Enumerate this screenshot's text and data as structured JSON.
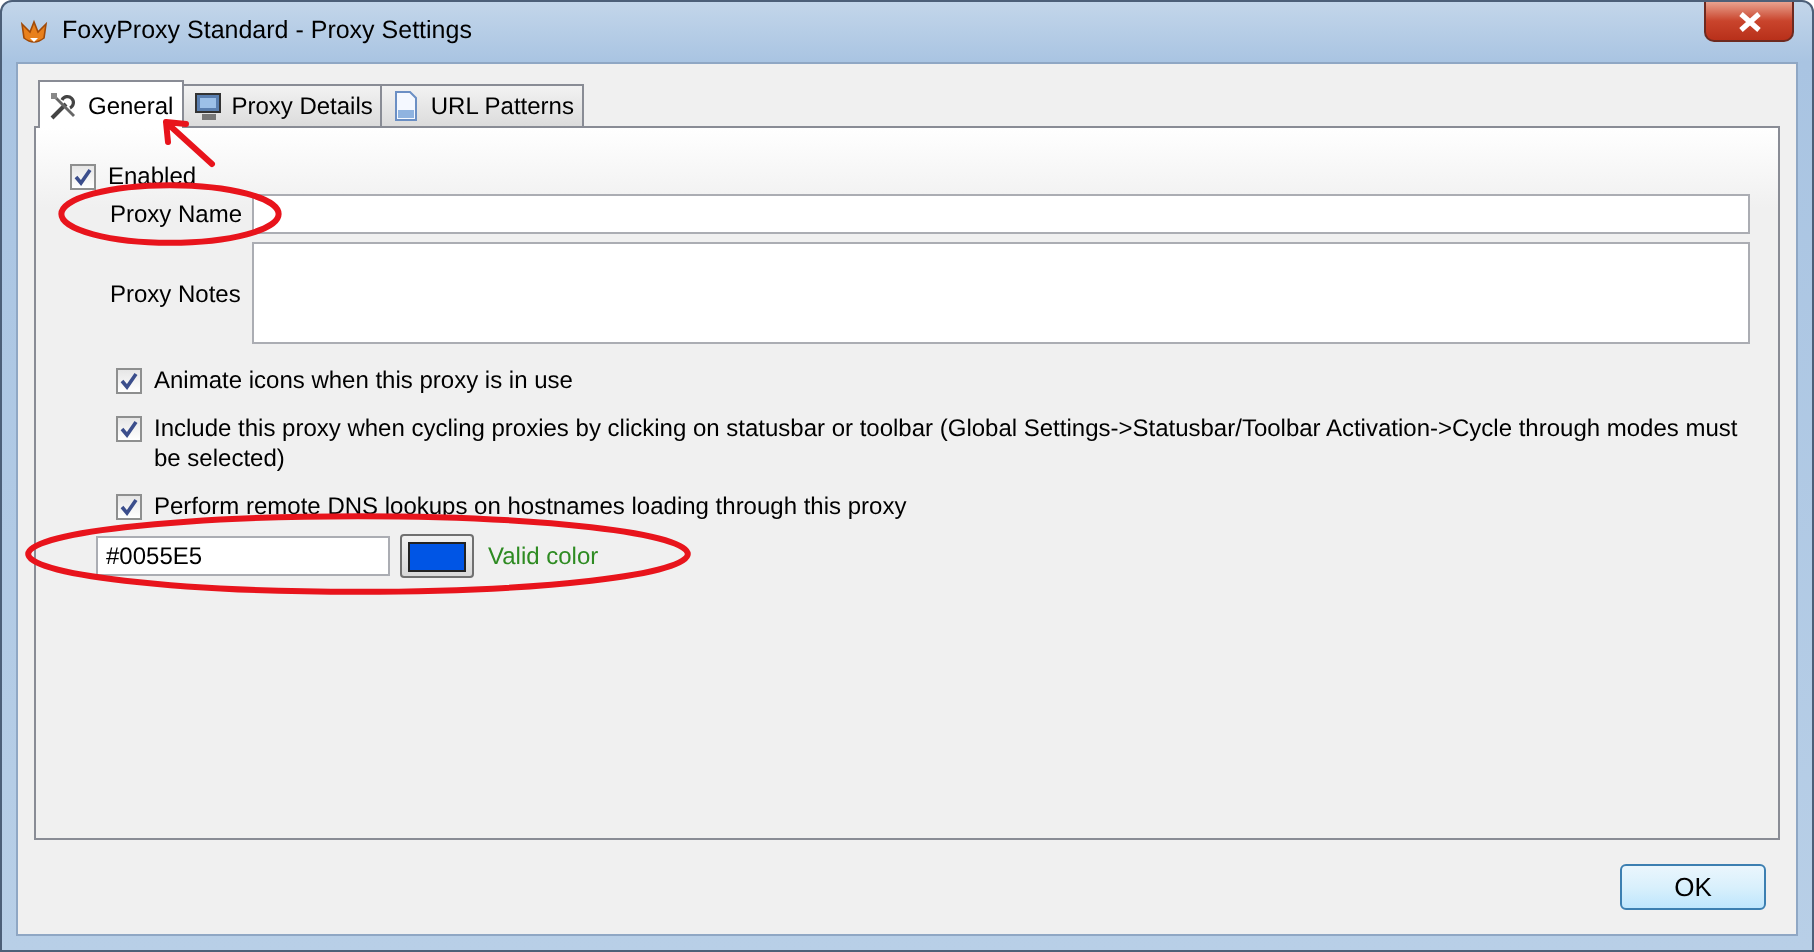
{
  "window": {
    "title": "FoxyProxy Standard - Proxy Settings"
  },
  "tabs": [
    {
      "label": "General",
      "selected": true,
      "annotated": true
    },
    {
      "label": "Proxy Details",
      "selected": false,
      "annotated": false
    },
    {
      "label": "URL Patterns",
      "selected": false,
      "annotated": false
    }
  ],
  "enabled": {
    "label": "Enabled",
    "checked": true
  },
  "proxy_name": {
    "label": "Proxy Name",
    "circled": true
  },
  "proxy_notes": {
    "label": "Proxy Notes"
  },
  "options": [
    {
      "label": "Animate icons when this proxy is in use",
      "checked": true
    },
    {
      "label": "Include this proxy when cycling proxies by clicking on statusbar or toolbar (Global Settings->Statusbar/Toolbar Activation->Cycle through modes must be selected)",
      "checked": true
    },
    {
      "label": "Perform remote DNS lookups on hostnames loading through this proxy",
      "checked": true
    }
  ],
  "color": {
    "value": "#0055E5",
    "status": "Valid color",
    "circled": true
  },
  "buttons": [
    {
      "label": "OK"
    }
  ]
}
